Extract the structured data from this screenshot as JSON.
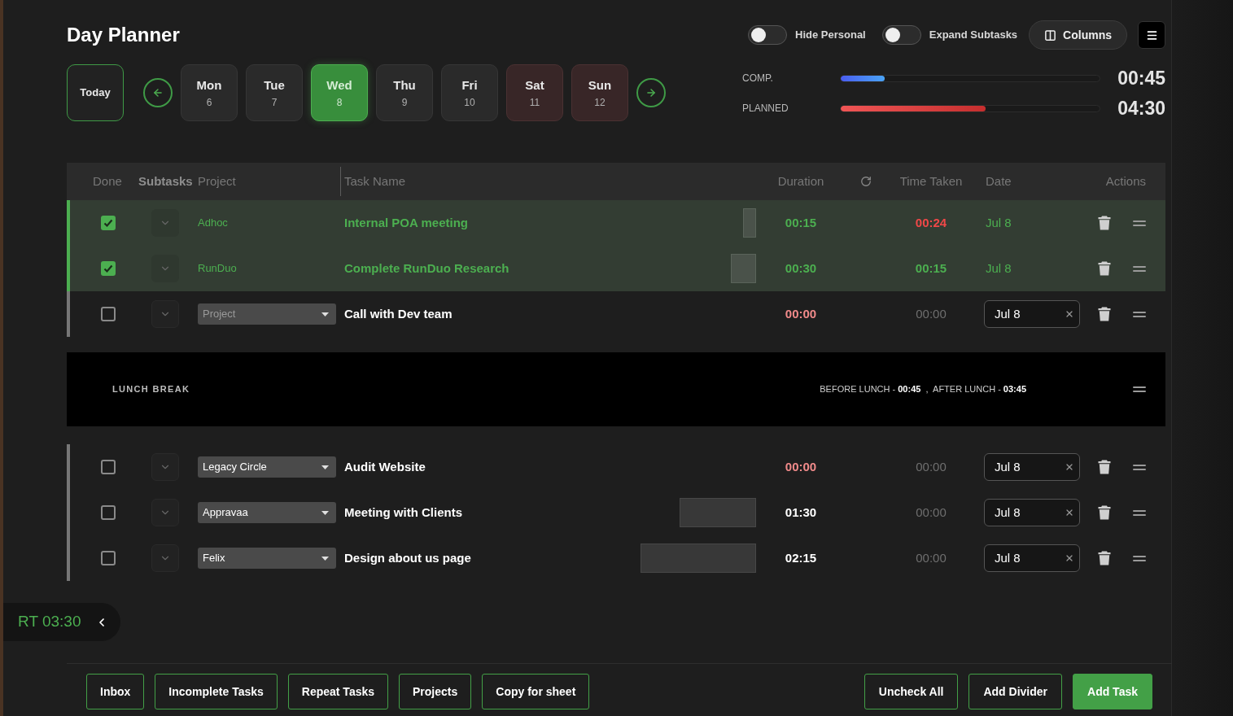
{
  "title": "Day Planner",
  "toggles": [
    {
      "label": "Hide Personal",
      "on": false
    },
    {
      "label": "Expand Subtasks",
      "on": false
    }
  ],
  "columns_button": "Columns",
  "week": {
    "today": "Today",
    "days": [
      {
        "name": "Mon",
        "date": "6",
        "selected": false,
        "weekend": false
      },
      {
        "name": "Tue",
        "date": "7",
        "selected": false,
        "weekend": false
      },
      {
        "name": "Wed",
        "date": "8",
        "selected": true,
        "weekend": false
      },
      {
        "name": "Thu",
        "date": "9",
        "selected": false,
        "weekend": false
      },
      {
        "name": "Fri",
        "date": "10",
        "selected": false,
        "weekend": false
      },
      {
        "name": "Sat",
        "date": "11",
        "selected": false,
        "weekend": true
      },
      {
        "name": "Sun",
        "date": "12",
        "selected": false,
        "weekend": true
      }
    ]
  },
  "progress": [
    {
      "kind": "completed",
      "label": "COMP.",
      "level": 0.17,
      "value": "00:45"
    },
    {
      "kind": "planned",
      "label": "PLANNED",
      "level": 0.56,
      "value": "04:30"
    }
  ],
  "table": {
    "columns": [
      {
        "label": "Done",
        "active": false
      },
      {
        "label": "Subtasks",
        "active": true
      },
      {
        "label": "Project",
        "active": false
      },
      {
        "label": "Task Name",
        "active": false
      },
      {
        "label": "Duration",
        "active": false
      },
      {
        "label": "Time Taken",
        "active": false
      },
      {
        "label": "Date",
        "active": false
      },
      {
        "label": "Actions",
        "active": false
      }
    ],
    "rows": [
      {
        "kind": "task",
        "done": true,
        "expanded": false,
        "project": {
          "value": "Adhoc"
        },
        "name": "Internal POA meeting",
        "level": 0.11,
        "duration": "00:15",
        "time_taken": "00:24",
        "over_time": true,
        "date": "Jul 8"
      },
      {
        "kind": "task",
        "done": true,
        "expanded": false,
        "project": {
          "value": "RunDuo"
        },
        "name": "Complete RunDuo Research",
        "level": 0.21,
        "duration": "00:30",
        "time_taken": "00:15",
        "over_time": false,
        "date": "Jul 8"
      },
      {
        "kind": "task",
        "done": false,
        "expanded": false,
        "project": {
          "placeholder": "Project"
        },
        "name": "Call with Dev team",
        "level": 0,
        "duration": "00:00",
        "time_taken": "00:00",
        "over_time": false,
        "date": "Jul 8"
      },
      {
        "kind": "divider",
        "label": "LUNCH BREAK",
        "summary": "BEFORE LUNCH - **00:45**  ,  AFTER LUNCH - **03:45**"
      },
      {
        "kind": "task",
        "done": false,
        "expanded": false,
        "project": {
          "value": "Legacy Circle"
        },
        "name": "Audit Website",
        "level": 0,
        "duration": "00:00",
        "time_taken": "00:00",
        "over_time": false,
        "date": "Jul 8"
      },
      {
        "kind": "task",
        "done": false,
        "expanded": false,
        "project": {
          "value": "Appravaa"
        },
        "name": "Meeting with Clients",
        "level": 0.63,
        "duration": "01:30",
        "time_taken": "00:00",
        "over_time": false,
        "date": "Jul 8"
      },
      {
        "kind": "task",
        "done": false,
        "expanded": false,
        "project": {
          "value": "Felix"
        },
        "name": "Design about us page",
        "level": 0.95,
        "duration": "02:15",
        "time_taken": "00:00",
        "over_time": false,
        "date": "Jul 8"
      }
    ]
  },
  "timer": {
    "label": "RT 03:30"
  },
  "footer": {
    "left": [
      "Inbox",
      "Incomplete Tasks",
      "Repeat Tasks",
      "Projects",
      "Copy for sheet"
    ],
    "right": [
      {
        "label": "Uncheck All",
        "primary": false
      },
      {
        "label": "Add Divider",
        "primary": false
      },
      {
        "label": "Add Task",
        "primary": true
      }
    ]
  }
}
